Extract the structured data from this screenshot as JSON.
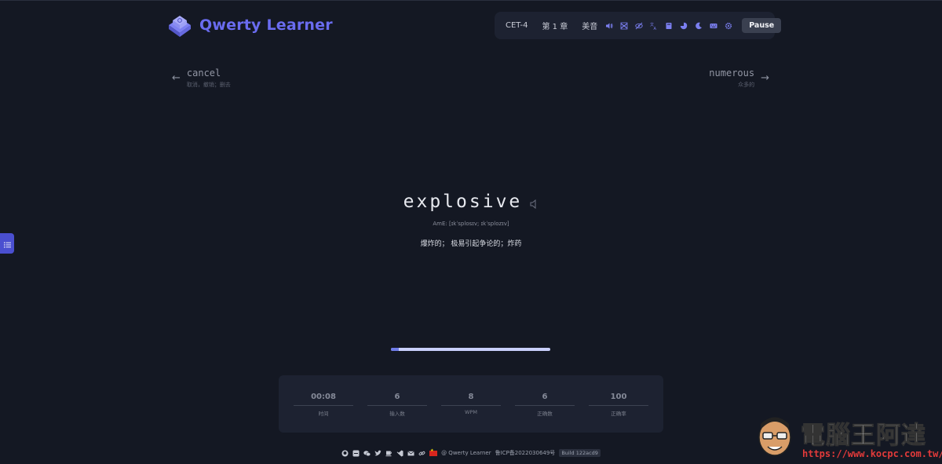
{
  "header": {
    "app_title": "Qwerty Learner"
  },
  "toolbar": {
    "dictionary": "CET-4",
    "chapter": "第 1 章",
    "pronunciation": "美音",
    "icons": [
      "volume-icon",
      "random-icon",
      "hide-word-icon",
      "translation-icon",
      "dictionary-book-icon",
      "analysis-icon",
      "dark-mode-icon",
      "keyboard-sound-icon",
      "settings-icon"
    ],
    "pause_label": "Pause",
    "accent_color": "#6a6cf0"
  },
  "prev_word": {
    "word": "cancel",
    "translation": "取消，撤销；删去"
  },
  "next_word": {
    "word": "numerous",
    "translation": "众多的"
  },
  "current": {
    "word": "explosive",
    "phonetic": "AmE: [ɪkˈsplosɪv; ɪkˈsplozɪv]",
    "translation": "爆炸的； 极易引起争论的；炸药"
  },
  "progress": {
    "fraction": 0.05
  },
  "stats": [
    {
      "value": "00:08",
      "label": "时间"
    },
    {
      "value": "6",
      "label": "输入数"
    },
    {
      "value": "8",
      "label": "WPM"
    },
    {
      "value": "6",
      "label": "正确数"
    },
    {
      "value": "100",
      "label": "正确率"
    }
  ],
  "footer": {
    "credit": "@ Qwerty Learner",
    "icp": "鲁ICP备2022030649号",
    "build": "Build 122acd9"
  },
  "watermark": {
    "title": "電腦王阿達",
    "url": "https://www.kocpc.com.tw/"
  }
}
